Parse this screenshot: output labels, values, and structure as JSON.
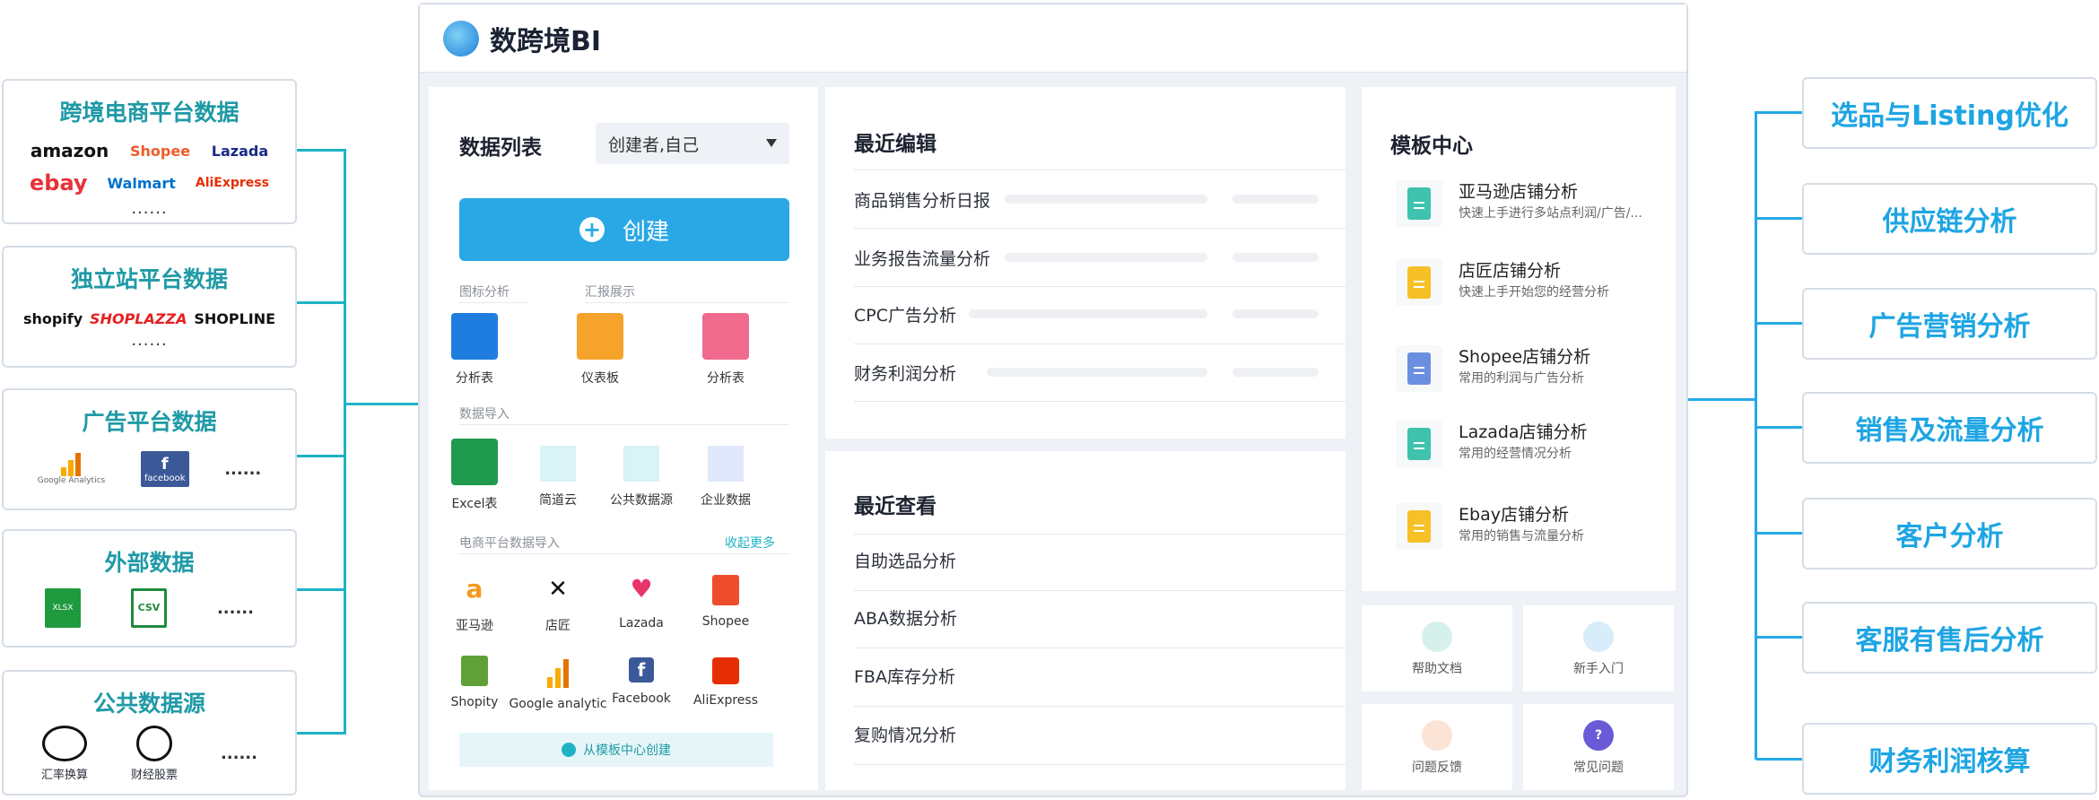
{
  "sources": [
    {
      "title": "跨境电商平台数据",
      "logos": [
        "amazon",
        "Shopee",
        "Lazada",
        "ebay",
        "Walmart",
        "AliExpress"
      ],
      "more": "......"
    },
    {
      "title": "独立站平台数据",
      "logos": [
        "shopify",
        "SHOPLAZZA",
        "SHOPLINE"
      ],
      "more": "......"
    },
    {
      "title": "广告平台数据",
      "logos": [
        "Google Analytics",
        "facebook"
      ],
      "more": "......"
    },
    {
      "title": "外部数据",
      "logos": [
        "XLSX",
        "CSV"
      ],
      "more": "......"
    },
    {
      "title": "公共数据源",
      "logos": [
        "汇率换算",
        "财经股票"
      ],
      "more": "......"
    }
  ],
  "app": {
    "brand": "数跨境BI",
    "data_list": {
      "title": "数据列表",
      "filter": "创建者,自己",
      "create": "创建",
      "sections": {
        "chart": "图标分析",
        "report": "汇报展示",
        "import": "数据导入",
        "ecom": "电商平台数据导入",
        "collapse": "收起更多"
      },
      "chart_tiles": [
        "分析表",
        "仪表板",
        "分析表"
      ],
      "import_tiles": [
        "Excel表",
        "简道云",
        "公共数据源",
        "企业数据"
      ],
      "ecom_tiles": [
        "亚马逊",
        "店匠",
        "Lazada",
        "Shopee",
        "Shopity",
        "Google analytic",
        "Facebook",
        "AliExpress"
      ],
      "from_template": "从模板中心创建"
    },
    "recent_edit": {
      "title": "最近编辑",
      "items": [
        "商品销售分析日报",
        "业务报告流量分析",
        "CPC广告分析",
        "财务利润分析"
      ]
    },
    "recent_view": {
      "title": "最近查看",
      "items": [
        "自助选品分析",
        "ABA数据分析",
        "FBA库存分析",
        "复购情况分析"
      ]
    },
    "template_center": {
      "title": "模板中心",
      "items": [
        {
          "name": "亚马逊店铺分析",
          "desc": "快速上手进行多站点利润/广告/...",
          "color": "#3fc2ae"
        },
        {
          "name": "店匠店铺分析",
          "desc": "快速上手开始您的经营分析",
          "color": "#f6c026"
        },
        {
          "name": "Shopee店铺分析",
          "desc": "常用的利润与广告分析",
          "color": "#6b8fe0"
        },
        {
          "name": "Lazada店铺分析",
          "desc": "常用的经营情况分析",
          "color": "#3fc2ae"
        },
        {
          "name": "Ebay店铺分析",
          "desc": "常用的销售与流量分析",
          "color": "#f6c026"
        }
      ]
    },
    "quick_links": [
      "帮助文档",
      "新手入门",
      "问题反馈",
      "常见问题"
    ]
  },
  "categories": [
    "选品与Listing优化",
    "供应链分析",
    "广告营销分析",
    "销售及流量分析",
    "客户分析",
    "客服有售后分析",
    "财务利润核算"
  ]
}
